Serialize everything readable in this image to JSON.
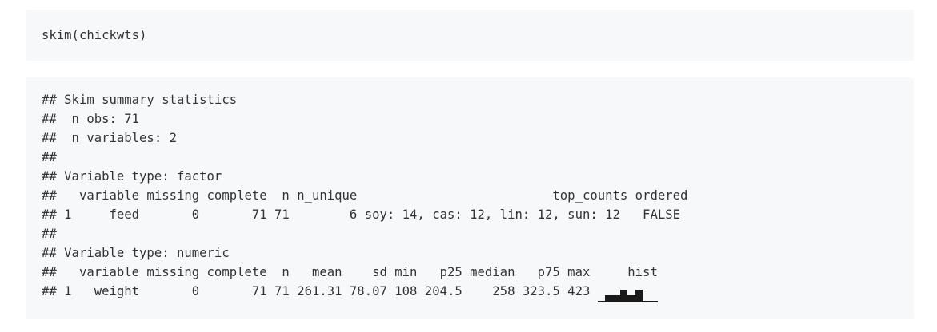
{
  "input": {
    "code": "skim(chickwts)"
  },
  "output": {
    "lines": [
      "## Skim summary statistics",
      "##  n obs: 71",
      "##  n variables: 2",
      "##",
      "## Variable type: factor",
      "##   variable missing complete  n n_unique                          top_counts ordered",
      "## 1     feed       0       71 71        6 soy: 14, cas: 12, lin: 12, sun: 12   FALSE",
      "##",
      "## Variable type: numeric",
      "##   variable missing complete  n   mean    sd min   p25 median   p75 max     hist"
    ],
    "last_line_prefix": "## 1   weight       0       71 71 261.31 78.07 108 204.5    258 323.5 423 ",
    "hist_levels": [
      0.12,
      0.55,
      0.55,
      1.0,
      0.55,
      1.0,
      0.12,
      0.12
    ]
  }
}
